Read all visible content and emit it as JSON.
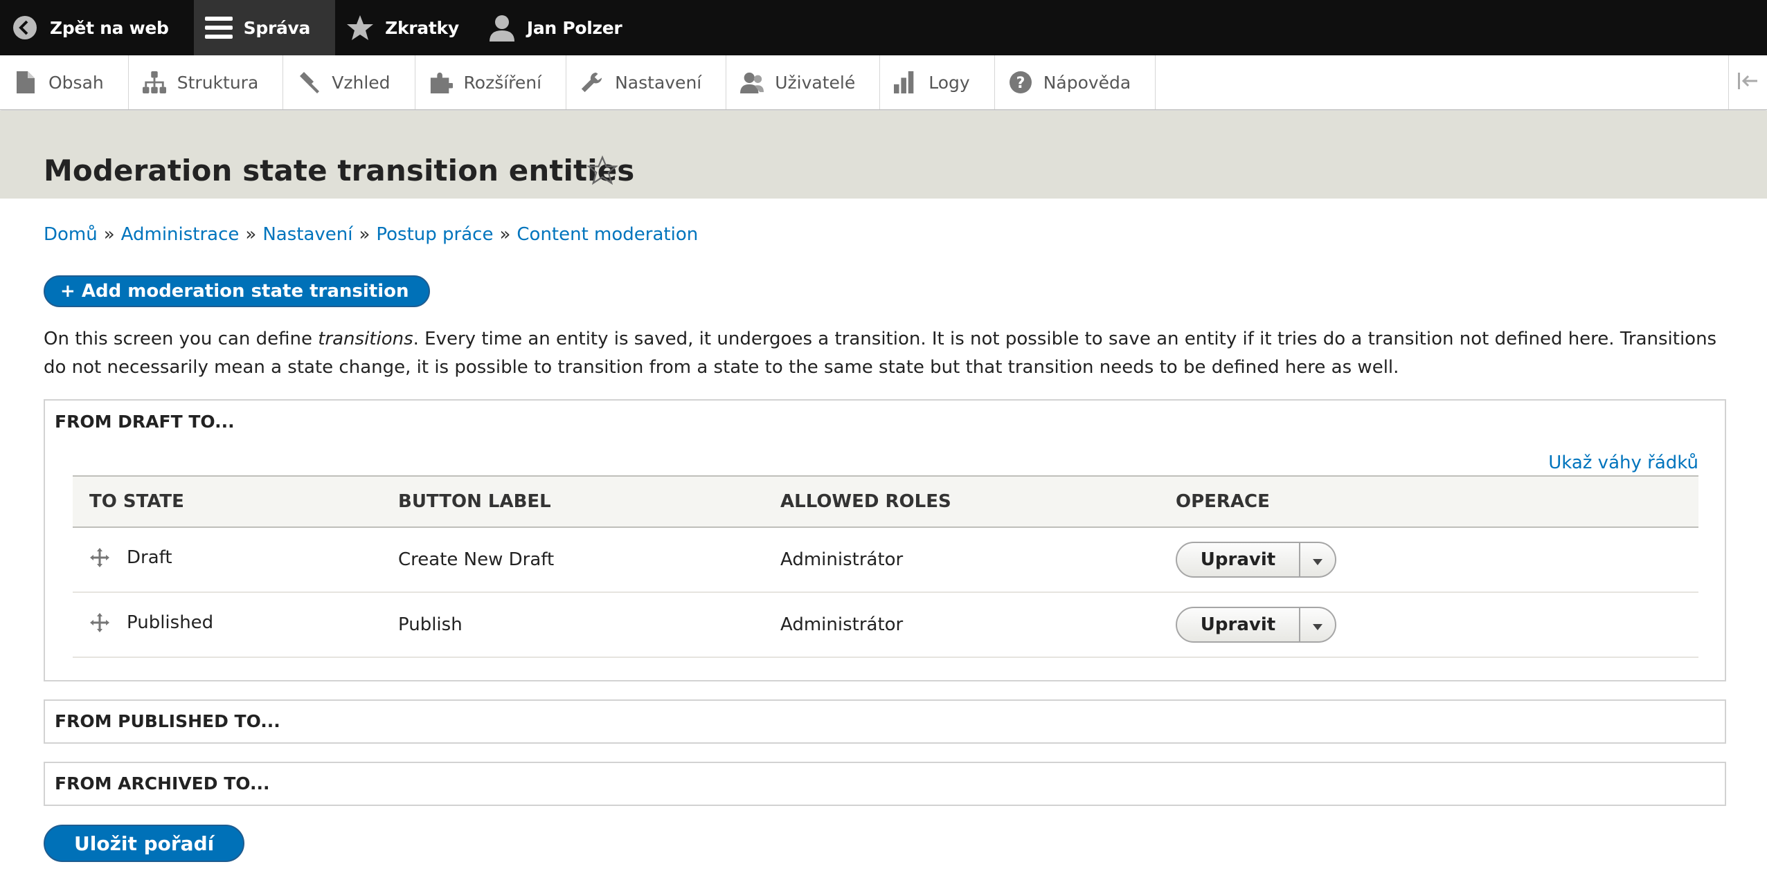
{
  "toolbar": {
    "back_label": "Zpět na web",
    "manage_label": "Správa",
    "shortcuts_label": "Zkratky",
    "user_label": "Jan Polzer"
  },
  "tray": {
    "items": [
      {
        "label": "Obsah",
        "icon": "file-icon"
      },
      {
        "label": "Struktura",
        "icon": "sitemap-icon"
      },
      {
        "label": "Vzhled",
        "icon": "paintbrush-icon"
      },
      {
        "label": "Rozšíření",
        "icon": "puzzle-icon"
      },
      {
        "label": "Nastavení",
        "icon": "wrench-icon"
      },
      {
        "label": "Uživatelé",
        "icon": "people-icon"
      },
      {
        "label": "Logy",
        "icon": "bar-chart-icon"
      },
      {
        "label": "Nápověda",
        "icon": "help-icon"
      }
    ]
  },
  "page": {
    "title": "Moderation state transition entities"
  },
  "breadcrumb": [
    "Domů",
    "Administrace",
    "Nastavení",
    "Postup práce",
    "Content moderation"
  ],
  "breadcrumb_separator": "»",
  "actions": {
    "add_label": "+ Add moderation state transition"
  },
  "description": {
    "part1": "On this screen you can define ",
    "emphasis": "transitions",
    "part2": ". Every time an entity is saved, it undergoes a transition. It is not possible to save an entity if it tries do a transition not defined here. Transitions do not necessarily mean a state change, it is possible to transition from a state to the same state but that transition needs to be defined here as well."
  },
  "groups": {
    "draft": {
      "legend": "FROM DRAFT TO...",
      "weights_link": "Ukaž váhy řádků",
      "headers": [
        "TO STATE",
        "BUTTON LABEL",
        "ALLOWED ROLES",
        "OPERACE"
      ],
      "rows": [
        {
          "to_state": "Draft",
          "button_label": "Create New Draft",
          "roles": "Administrátor",
          "op": "Upravit"
        },
        {
          "to_state": "Published",
          "button_label": "Publish",
          "roles": "Administrátor",
          "op": "Upravit"
        }
      ]
    },
    "published": {
      "legend": "FROM PUBLISHED TO..."
    },
    "archived": {
      "legend": "FROM ARCHIVED TO..."
    }
  },
  "save_label": "Uložit pořadí",
  "colors": {
    "link": "#0074bd",
    "primary_button": "#0071b8",
    "toolbar_bg": "#0f0f0f",
    "header_bg": "#e0e0d8"
  }
}
